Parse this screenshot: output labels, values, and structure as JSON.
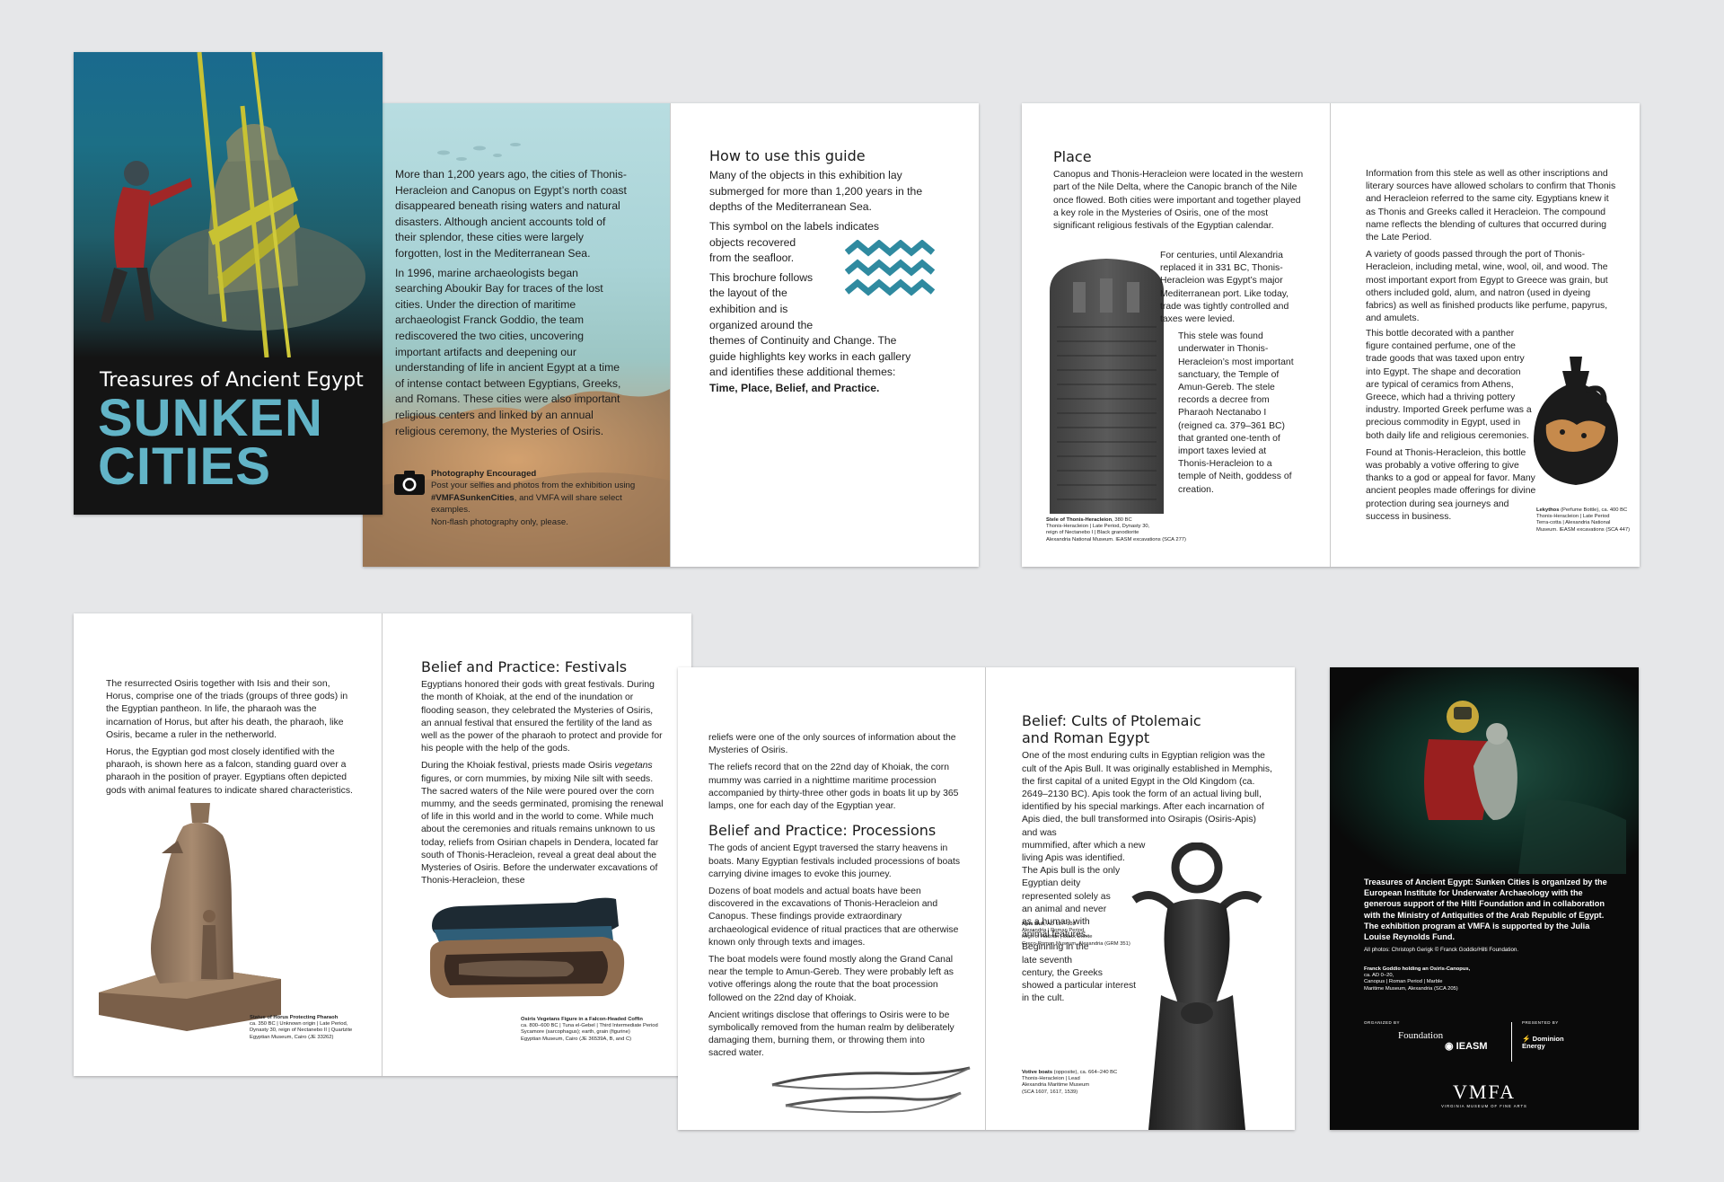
{
  "colors": {
    "accent": "#2f8aa0",
    "teal": "#62b4c7",
    "cover_bg": "#141414",
    "back_bg": "#0a0a0a",
    "page": "#ffffff",
    "gallery_bg": "#e6e7e9"
  },
  "cover": {
    "subtitle": "Treasures of Ancient Egypt",
    "title_line1": "SUNKEN",
    "title_line2": "CITIES"
  },
  "intro": {
    "paragraphs": [
      "More than 1,200 years ago, the cities of Thonis-Heracleion and Canopus on Egypt’s north coast disappeared beneath rising waters and natural disasters. Although ancient accounts told of their splendor, these cities were largely forgotten, lost in the Mediterranean Sea.",
      "In 1996, marine archaeologists began searching Aboukir Bay for traces of the lost cities. Under the direction of maritime archaeologist Franck Goddio, the team rediscovered the two cities, uncovering important artifacts and deepening our understanding of life in ancient Egypt at a time of intense contact between Egyptians, Greeks, and Romans. These cities were also important religious centers and linked by an annual religious ceremony, the Mysteries of Osiris."
    ],
    "photo_heading": "Photography Encouraged",
    "photo_text_a": "Post your selfies and photos from the exhibition using ",
    "photo_hashtag": "#VMFASunkenCities",
    "photo_text_b": ", and VMFA will share select examples.",
    "photo_line2": "Non-flash photography only, please."
  },
  "howto": {
    "heading": "How to use this guide",
    "p1": "Many of the objects in this exhibition lay submerged for more than 1,200 years in the depths of the Mediterranean Sea.",
    "p2a": "This symbol on the labels indicates",
    "p2b": "objects recovered",
    "p2c": "from the seafloor.",
    "p3a": "This brochure follows",
    "p3b": "the layout of the",
    "p3c": "exhibition and is",
    "p3d": "organized around the",
    "p3e": "themes of Continuity and Change. The guide highlights key works in each gallery and identifies these additional themes:",
    "p3_bold": "Time, Place, Belief, and Practice.",
    "wave_icon": "wave-symbol-icon"
  },
  "place": {
    "heading": "Place",
    "p1": "Canopus and Thonis-Heracleion were located in the western part of the Nile Delta, where the Canopic branch of the Nile once flowed. Both cities were important and together played a key role in the Mysteries of Osiris, one of the most significant religious festivals of the Egyptian calendar.",
    "p2": "For centuries, until Alexandria replaced it in 331 BC, Thonis-Heracleion was Egypt’s major Mediterranean port. Like today, trade was tightly controlled and taxes were levied.",
    "p3": "This stele was found underwater in Thonis-Heracleion’s most important sanctuary, the Temple of Amun-Gereb. The stele records a decree from Pharaoh Nectanabo I (reigned ca. 379–361 BC) that granted one-tenth of import taxes levied at Thonis-Heracleion to a temple of Neith, goddess of creation.",
    "caption_title": "Stele of Thonis-Heracleion",
    "caption_date": ", 380 BC",
    "caption_lines": [
      "Thonis-Heracleion | Late Period, Dynasty 30,",
      "reign of Nectanebo I | Black granodiorite",
      "Alexandria National Museum. IEASM excavations (SCA 277)"
    ]
  },
  "trade": {
    "p1": "Information from this stele as well as other inscriptions and literary sources have allowed scholars to confirm that Thonis and Heracleion referred to the same city. Egyptians knew it as Thonis and Greeks called it Heracleion. The compound name reflects the blending of cultures that occurred during the Late Period.",
    "p2": "A variety of goods passed through the port of Thonis-Heracleion, including metal, wine, wool, oil, and wood. The most important export from Egypt to Greece was grain, but others included gold, alum, and natron (used in dyeing fabrics) as well as finished products like perfume, papyrus, and amulets.",
    "p3": "This bottle decorated with a panther figure contained perfume, one of the trade goods that was taxed upon entry into Egypt. The shape and decoration are typical of ceramics from Athens, Greece, which had a thriving pottery industry. Imported Greek perfume was a precious commodity in Egypt, used in both daily life and religious ceremonies.",
    "p4": "Found at Thonis-Heracleion, this bottle was probably a votive offering to give thanks to a god or appeal for favor. Many ancient peoples made offerings for divine protection during sea journeys and success in business.",
    "caption_title": "Lekythos",
    "caption_rest": " (Perfume Bottle), ca. 400 BC",
    "caption_lines": [
      "Thonis-Heracleion | Late Period",
      "Terra-cotta | Alexandria National",
      "Museum. IEASM excavations (SCA 447)"
    ]
  },
  "osiris": {
    "p1": "The resurrected Osiris together with Isis and their son, Horus, comprise one of the triads (groups of three gods) in the Egyptian pantheon. In life, the pharaoh was the incarnation of Horus, but after his death, the pharaoh, like Osiris, became a ruler in the netherworld.",
    "p2": "Horus, the Egyptian god most closely identified with the pharaoh, is shown here as a falcon, standing guard over a pharaoh in the position of prayer. Egyptians often depicted gods with animal features to indicate shared characteristics.",
    "caption_title": "Statue of Horus Protecting Pharaoh",
    "caption_lines": [
      "ca. 350 BC | Unknown origin | Late Period,",
      "Dynasty 30, reign of Nectanebo II | Quartzite",
      "Egyptian Museum, Cairo (JE 33262)"
    ]
  },
  "festivals": {
    "heading": "Belief and Practice: Festivals",
    "p1": "Egyptians honored their gods with great festivals. During the month of Khoiak, at the end of the inundation or flooding season, they celebrated the Mysteries of Osiris, an annual festival that ensured the fertility of the land as well as the power of the pharaoh to protect and provide for his people with the help of the gods.",
    "p2a": "During the Khoiak festival, priests made Osiris ",
    "p2_italic": "vegetans",
    "p2b": " figures, or corn mummies, by mixing Nile silt with seeds. The sacred waters of the Nile were poured over the corn mummy, and the seeds germinated, promising the renewal of life in this world and in the world to come. While much about the ceremonies and rituals remains unknown to us today, reliefs from Osirian chapels in Dendera, located far south of Thonis-Heracleion, reveal a great deal about the Mysteries of Osiris. Before the underwater excavations of Thonis-Heracleion, these",
    "caption_title": "Osiris Vegetans Figure in a Falcon-Headed Coffin",
    "caption_lines": [
      "ca. 800–600 BC | Tuna el-Gebel | Third Intermediate Period",
      "Sycamore (sarcophagus); earth, grain (figurine)",
      "Egyptian Museum, Cairo (JE 36539A, B, and C)"
    ]
  },
  "processions": {
    "p0": "reliefs were one of the only sources of information about the Mysteries of Osiris.",
    "p1": "The reliefs record that on the 22nd day of Khoiak, the corn mummy was carried in a nighttime maritime procession accompanied by thirty-three other gods in boats lit up by 365 lamps, one for each day of the Egyptian year.",
    "heading": "Belief and Practice: Processions",
    "p2": "The gods of ancient Egypt traversed the starry heavens in boats. Many Egyptian festivals included processions of boats carrying divine images to evoke this journey.",
    "p3": "Dozens of boat models and actual boats have been discovered in the excavations of Thonis-Heracleion and Canopus. These findings provide extraordinary archaeological evidence of ritual practices that are otherwise known only through texts and images.",
    "p4": "The boat models were found mostly along the Grand Canal near the temple to Amun-Gereb. They were probably left as votive offerings along the route that the boat procession followed on the 22nd day of Khoiak.",
    "p5": "Ancient writings disclose that offerings to Osiris were to be symbolically removed from the human realm by deliberately damaging them, burning them, or throwing them into",
    "p5b": "sacred water."
  },
  "cults": {
    "heading_line1": "Belief: Cults of Ptolemaic",
    "heading_line2": "and Roman Egypt",
    "p1": "One of the most enduring cults in Egyptian religion was the cult of the Apis Bull. It was originally established in Memphis, the first capital of a united Egypt in the Old Kingdom (ca. 2649–2130 BC). Apis took the form of an actual living bull, identified by his special markings. After each incarnation of Apis died, the bull transformed into Osirapis (Osiris-Apis) and was",
    "p1_short": [
      "mummified, after which a new",
      "living Apis was identified."
    ],
    "p2_short": [
      "The Apis bull is the only",
      "Egyptian deity",
      "represented solely as",
      "an animal and never",
      "as a human with",
      "animal features.",
      "Beginning in the",
      "late seventh",
      "century, the Greeks",
      "showed a particular interest",
      "in the cult."
    ],
    "cap1_title": "Apis Bull",
    "cap1_rest": ", AD 117–138",
    "cap1_lines": [
      "Alexandria | Roman Period,",
      "reign of Hadrian | Black Diorite",
      "Greco-Roman Museum, Alexandria (GRM 351)"
    ],
    "cap2_title": "Votive boats",
    "cap2_rest": " (opposite), ca. 664–240 BC",
    "cap2_lines": [
      "Thonis-Heracleion | Lead",
      "Alexandria Maritime Museum",
      "(SCA 1607, 1617, 1539)"
    ]
  },
  "back": {
    "credit_bold": "Treasures of Ancient Egypt: Sunken Cities is organized by the European Institute for Underwater Archaeology with the generous support of the Hilti Foundation and in collaboration with the Ministry of Antiquities of the Arab Republic of Egypt. The exhibition program at VMFA is supported by the Julia Louise Reynolds Fund.",
    "photos": "All photos: Christoph Gerigk © Franck Goddio/Hilti Foundation.",
    "cap_title": "Franck Goddio holding an Osiris-Canopus,",
    "cap_lines": [
      "ca. AD 0–20,",
      "Canopus | Roman Period | Marble",
      "Maritime Museum, Alexandria (SCA 205)"
    ],
    "organized_by": "ORGANIZED BY",
    "presented_by": "PRESENTED BY",
    "logo_foundation": "Foundation",
    "logo_ieasm": "IEASM",
    "logo_dominion": "Dominion Energy",
    "vmfa": "VMFA",
    "vmfa_sub": "VIRGINIA MUSEUM OF FINE ARTS"
  }
}
